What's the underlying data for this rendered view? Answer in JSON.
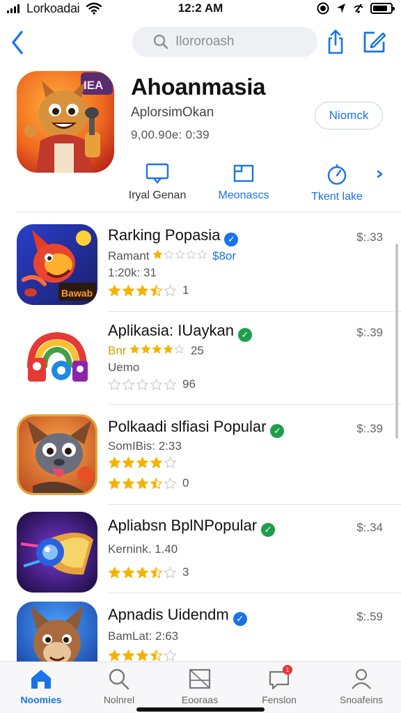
{
  "status_bar": {
    "carrier": "Lorkoadai",
    "time": "12:2 AM",
    "icons": [
      "signal-icon",
      "wifi-icon",
      "moon-icon",
      "location-arrow-icon",
      "no-signal-icon",
      "battery-icon"
    ],
    "battery_level": 0.85
  },
  "nav": {
    "back_icon": "chevron-left-icon",
    "search_placeholder": "Ilororoash",
    "share_icon": "share-icon",
    "compose_icon": "compose-icon"
  },
  "app": {
    "icon_badge": "IEA",
    "title": "Ahoanmasia",
    "subtitle": "AplorsimOkan",
    "meta": "9,00.90e: 0:39",
    "get_label": "Niomck",
    "actions": [
      {
        "icon": "message-icon",
        "label": "Iryal Genan"
      },
      {
        "icon": "window-icon",
        "label": "Meonascs"
      },
      {
        "icon": "timer-icon",
        "label": "Tkent lake"
      }
    ],
    "more_icon": "chevron-right-icon"
  },
  "list": [
    {
      "title": "Rarking Popasia",
      "badge": "blue",
      "price": "$:.33",
      "line1_pre": "Ramant",
      "line1_accent": "$8or",
      "line1_stars": 1,
      "line2": "1:20k: 31",
      "rating": 3.5,
      "rating_count": "1",
      "icon_text": "Bawab"
    },
    {
      "title": "Aplikasia: IUaykan",
      "badge": "green",
      "price": "$:.39",
      "line1_pre": "Bnr",
      "line1_stars": 4,
      "line1_count": "25",
      "line2": "Uemo",
      "rating": 0,
      "rating_count": "96"
    },
    {
      "title": "Polkaadi slfiasi Popular",
      "badge": "green",
      "price": "$:.39",
      "line1": "SomIBis: 2:33",
      "line1_stars": 4,
      "rating": 3.5,
      "rating_count": "0"
    },
    {
      "title": "Apliabsn BplNPopular",
      "badge": "green",
      "price": "$:.34",
      "line1": "Kernink. 1.40",
      "rating": 3.5,
      "rating_count": "3"
    },
    {
      "title": "Apnadis Uidendm",
      "badge": "blue",
      "price": "$:.59",
      "line1": "BamLat: 2:63",
      "rating": 3.5,
      "rating_count": ""
    }
  ],
  "tabs": [
    {
      "icon": "home-icon",
      "label": "Noomies",
      "active": true
    },
    {
      "icon": "search-icon",
      "label": "Nolnrel",
      "active": false
    },
    {
      "icon": "inbox-icon",
      "label": "Eooraas",
      "active": false
    },
    {
      "icon": "chat-bubble-icon",
      "label": "Fenslon",
      "active": false,
      "badge": "1"
    },
    {
      "icon": "person-icon",
      "label": "Snoafeins",
      "active": false
    }
  ],
  "colors": {
    "accent": "#1a73e8",
    "star": "#f5b301",
    "verified_green": "#1e9e4a",
    "notification": "#e53935"
  }
}
